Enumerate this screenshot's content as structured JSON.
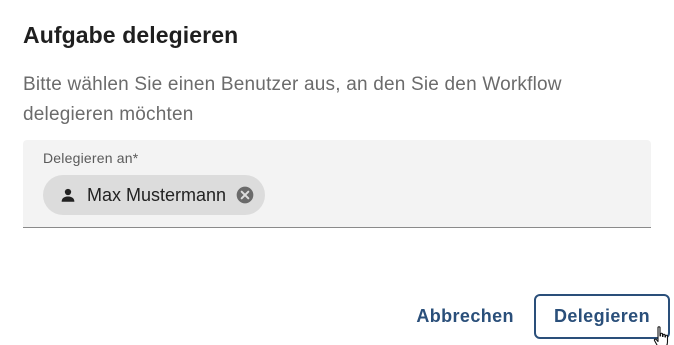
{
  "dialog": {
    "title": "Aufgabe delegieren",
    "description": "Bitte wählen Sie einen Benutzer aus, an den Sie den Workflow delegieren möchten"
  },
  "field": {
    "label": "Delegieren an*",
    "chip": {
      "icon": "person-icon",
      "text": "Max Mustermann",
      "remove_icon": "cancel-circle-icon"
    }
  },
  "actions": {
    "cancel_label": "Abbrechen",
    "delegate_label": "Delegieren"
  },
  "colors": {
    "primary": "#2a4f7a",
    "field_background": "#f3f3f3",
    "chip_background": "#dcdcdc",
    "description_text": "#6b6b6b"
  }
}
